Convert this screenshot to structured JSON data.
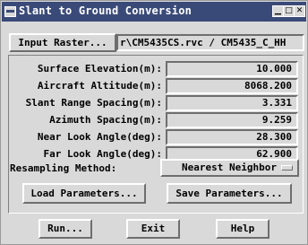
{
  "window": {
    "title": "Slant to Ground Conversion",
    "controls": {
      "minimize": "▁",
      "maximize": "□",
      "close": "✕"
    }
  },
  "input": {
    "button_label": "Input Raster...",
    "path": "r\\CM5435CS.rvc / CM5435_C_HH"
  },
  "params": [
    {
      "label": "Surface Elevation(m):",
      "value": "10.000"
    },
    {
      "label": "Aircraft Altitude(m):",
      "value": "8068.200"
    },
    {
      "label": "Slant Range Spacing(m):",
      "value": "3.331"
    },
    {
      "label": "Azimuth Spacing(m):",
      "value": "9.259"
    },
    {
      "label": "Near Look Angle(deg):",
      "value": "28.300"
    },
    {
      "label": "Far Look Angle(deg):",
      "value": "62.900"
    }
  ],
  "resampling": {
    "label": "Resampling Method:",
    "selected": "Nearest Neighbor"
  },
  "buttons": {
    "load": "Load Parameters...",
    "save": "Save Parameters...",
    "run": "Run...",
    "exit": "Exit",
    "help": "Help"
  },
  "colors": {
    "titlebar": "#3a4a78",
    "background": "#d9d9d9"
  }
}
